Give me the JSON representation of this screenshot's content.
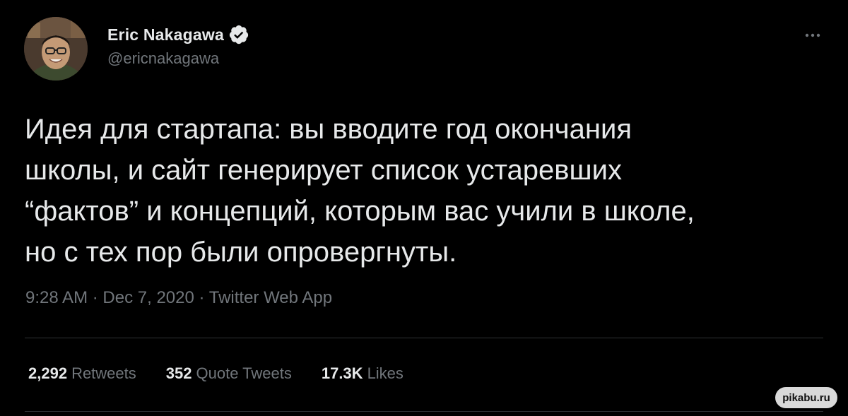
{
  "tweet": {
    "author": {
      "name": "Eric Nakagawa",
      "handle": "@ericnakagawa",
      "verified_icon": "verified-badge-icon"
    },
    "more_icon": "more-options-icon",
    "text": "Идея для стартапа: вы вводите год окончания\nшколы, и сайт генерирует список устаревших\n“фактов” и концепций, которым вас учили в школе,\nно с тех пор были опровергнуты.",
    "time": "9:28 AM",
    "date": "Dec 7, 2020",
    "source": "Twitter Web App",
    "separator": "·",
    "stats": {
      "retweets_count": "2,292",
      "retweets_label": "Retweets",
      "quotes_count": "352",
      "quotes_label": "Quote Tweets",
      "likes_count": "17.3K",
      "likes_label": "Likes"
    }
  },
  "watermark": "pikabu.ru",
  "colors": {
    "background": "#000000",
    "primary_text": "#e7e9ea",
    "secondary_text": "#71767b",
    "divider": "#2f3336",
    "verified_badge": "#e7e9ea"
  }
}
